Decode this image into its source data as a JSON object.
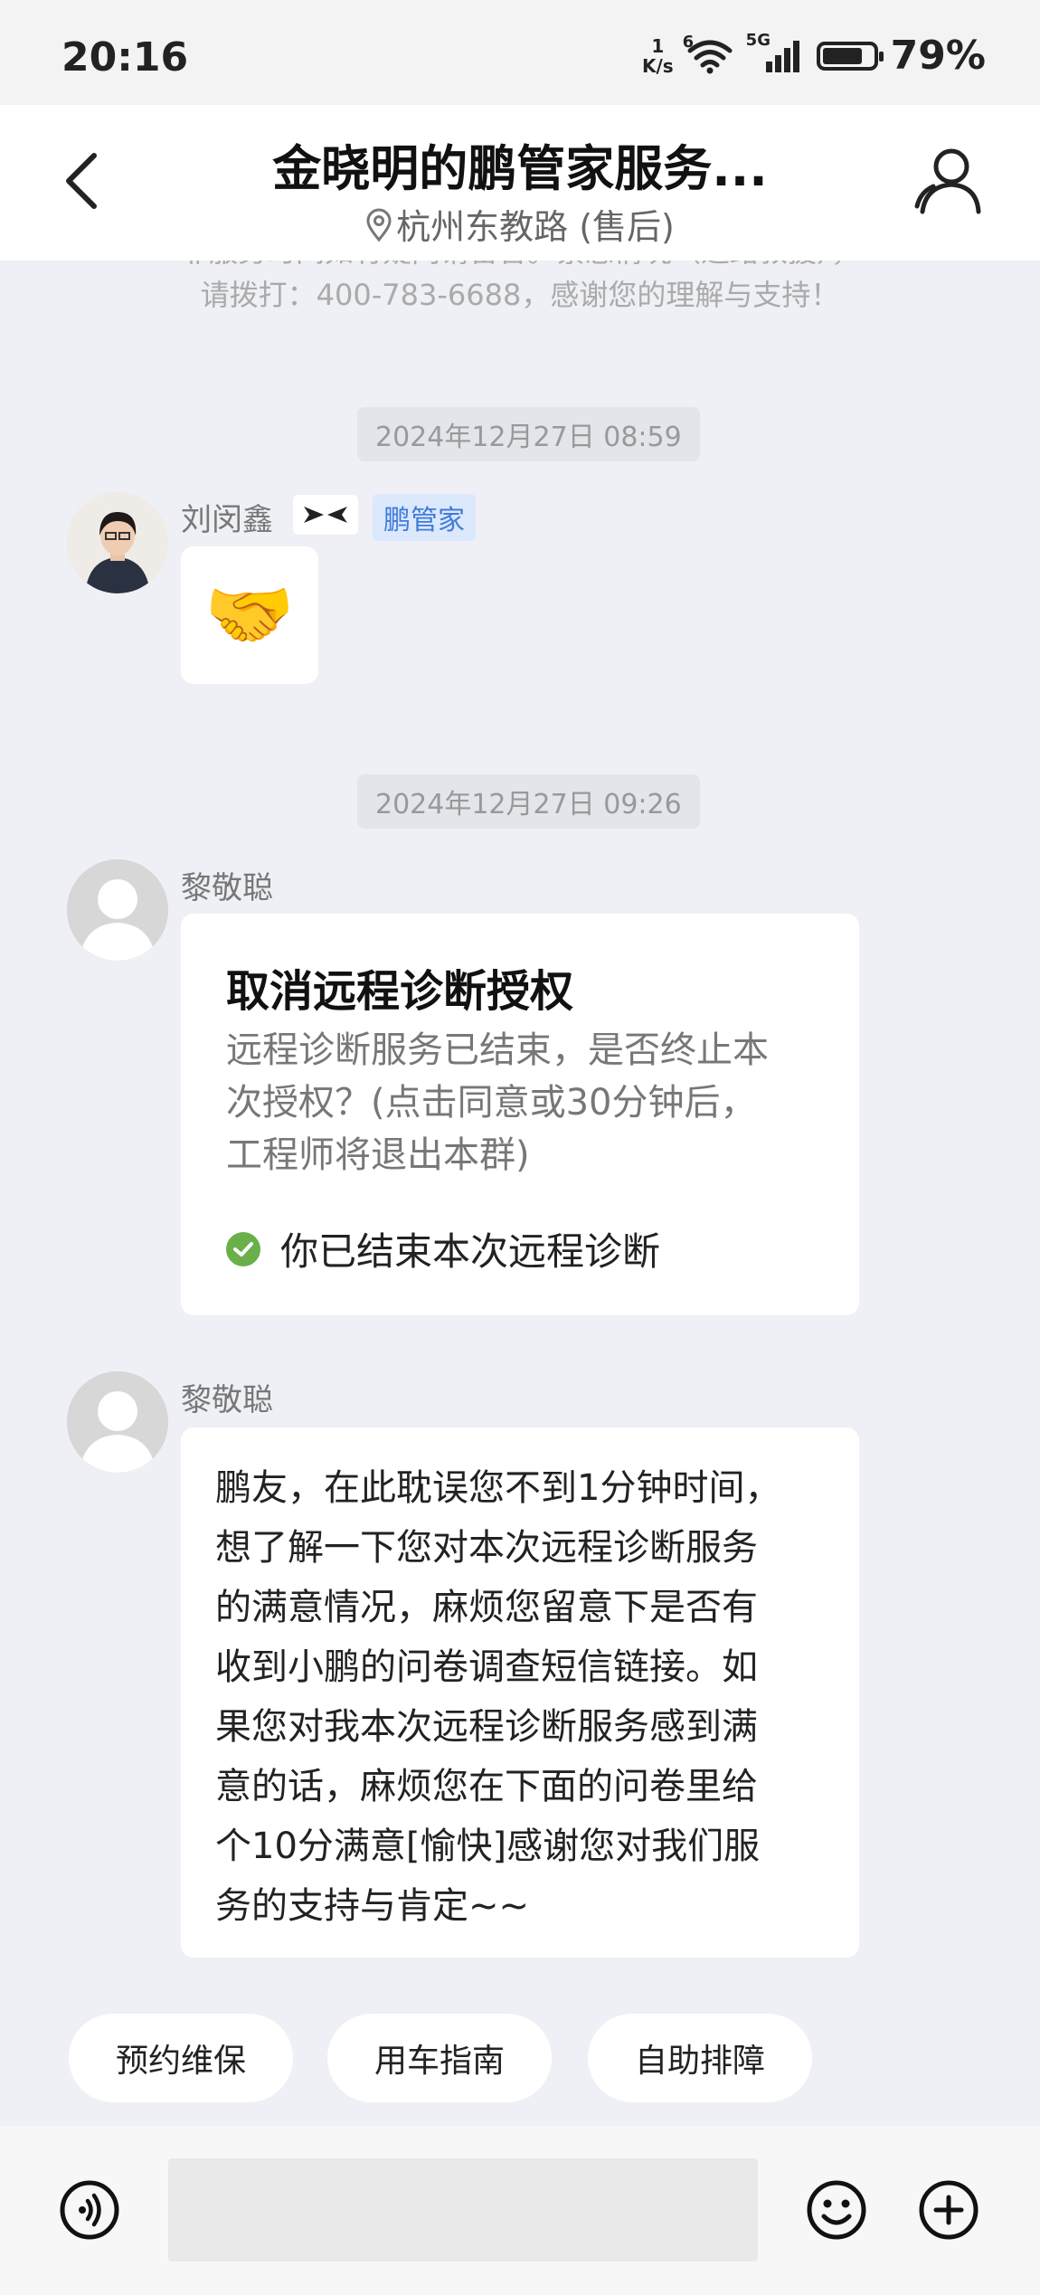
{
  "status_bar": {
    "time": "20:16",
    "net_speed_value": "1",
    "net_speed_unit": "K/s",
    "wifi_tag": "6",
    "cell_tag": "5G",
    "battery_percent": "79%",
    "battery_level": 0.79
  },
  "header": {
    "title": "金晓明的鹏管家服务...",
    "location": "杭州东教路 (售后)"
  },
  "notice": {
    "line1": "非服务时间如有疑问请留言。紧急情况（道路救援），",
    "line2": "请拨打：400-783-6688，感谢您的理解与支持！"
  },
  "messages": [
    {
      "timestamp": "2024年12月27日 08:59",
      "sender": "刘闵鑫",
      "role_badge": "鹏管家",
      "content_icon": "handshake-emoji",
      "content_glyph": "🤝"
    },
    {
      "timestamp": "2024年12月27日 09:26",
      "sender": "黎敬聪",
      "card": {
        "title": "取消远程诊断授权",
        "body_lines": [
          "远程诊断服务已结束，是否终止本",
          "次授权？(点击同意或30分钟后，",
          "工程师将退出本群)"
        ],
        "status_text": "你已结束本次远程诊断"
      }
    },
    {
      "sender": "黎敬聪",
      "lines": [
        "鹏友，在此耽误您不到1分钟时间，",
        "想了解一下您对本次远程诊断服务",
        "的满意情况，麻烦您留意下是否有",
        "收到小鹏的问卷调查短信链接。如",
        "果您对我本次远程诊断服务感到满",
        "意的话，麻烦您在下面的问卷里给",
        "个10分满意[愉快]感谢您对我们服",
        "务的支持与肯定~~"
      ]
    }
  ],
  "quick_actions": [
    "预约维保",
    "用车指南",
    "自助排障"
  ],
  "input_bar": {
    "placeholder": ""
  },
  "colors": {
    "page_bg": "#eef0f5",
    "role_badge_bg": "#dce8fb",
    "role_badge_text": "#3e7bdc",
    "check_green": "#69b04a"
  }
}
